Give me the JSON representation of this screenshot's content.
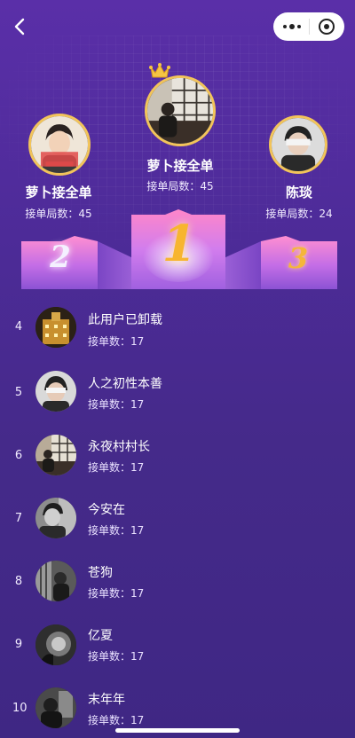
{
  "leaderboard": {
    "first": {
      "rank": "1",
      "name": "萝卜接全单",
      "count_text": "接单局数：45",
      "avatar_icon": "avatar-photo"
    },
    "second": {
      "rank": "2",
      "name": "萝卜接全单",
      "count_text": "接单局数：45",
      "avatar_icon": "avatar-photo"
    },
    "third": {
      "rank": "3",
      "name": "陈琰",
      "count_text": "接单局数：24",
      "avatar_icon": "avatar-photo"
    }
  },
  "list": [
    {
      "rank": "4",
      "name": "此用户已卸载",
      "count_text": "接单数：17"
    },
    {
      "rank": "5",
      "name": "人之初性本善",
      "count_text": "接单数：17"
    },
    {
      "rank": "6",
      "name": "永夜村村长",
      "count_text": "接单数：17"
    },
    {
      "rank": "7",
      "name": "今安在",
      "count_text": "接单数：17"
    },
    {
      "rank": "8",
      "name": "苍狗",
      "count_text": "接单数：17"
    },
    {
      "rank": "9",
      "name": "亿夏",
      "count_text": "接单数：17"
    },
    {
      "rank": "10",
      "name": "末年年",
      "count_text": "接单数：17"
    }
  ],
  "colors": {
    "background": "#4a2a8e",
    "gold": "#f2c45a",
    "podium_pink": "#ff8fd1"
  }
}
